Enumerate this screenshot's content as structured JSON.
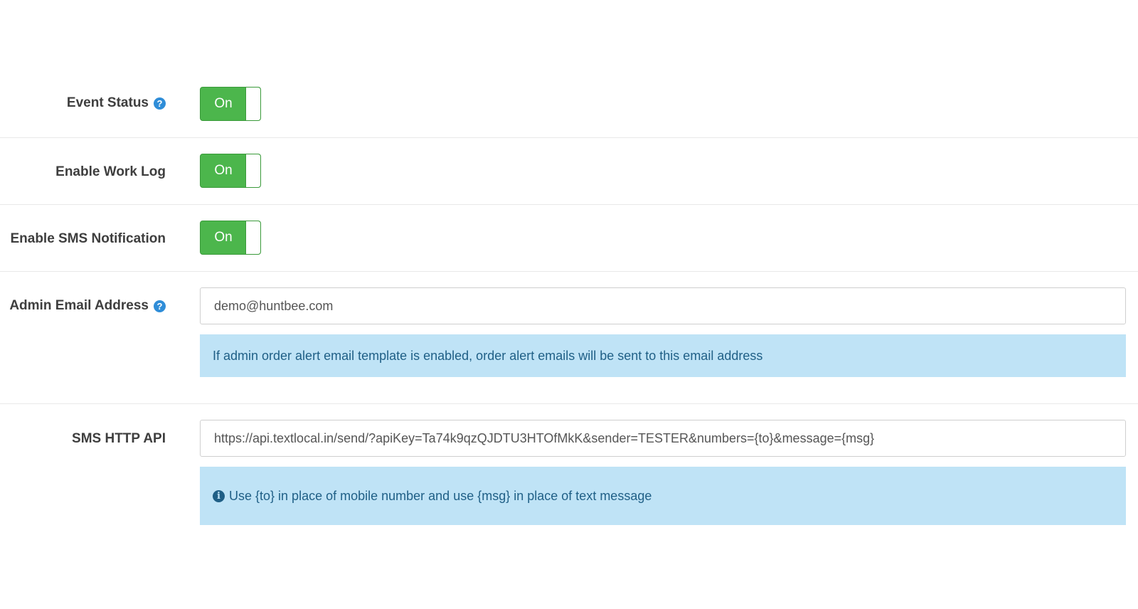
{
  "settings": {
    "event_status": {
      "label": "Event Status",
      "toggle": "On"
    },
    "enable_work_log": {
      "label": "Enable Work Log",
      "toggle": "On"
    },
    "enable_sms_notification": {
      "label": "Enable SMS Notification",
      "toggle": "On"
    },
    "admin_email": {
      "label": "Admin Email Address",
      "value": "demo@huntbee.com",
      "help_text": "If admin order alert email template is enabled, order alert emails will be sent to this email address"
    },
    "sms_http_api": {
      "label": "SMS HTTP API",
      "value": "https://api.textlocal.in/send/?apiKey=Ta74k9qzQJDTU3HTOfMkK&sender=TESTER&numbers={to}&message={msg}",
      "help_text": "Use {to} in place of mobile number and use {msg} in place of text message"
    }
  },
  "icons": {
    "help": "question-circle-icon",
    "info": "info-circle-icon"
  },
  "colors": {
    "toggle_on": "#4cb64c",
    "help_icon": "#2f8dd8",
    "info_bg": "#bfe3f6",
    "info_text": "#1f5f86"
  }
}
